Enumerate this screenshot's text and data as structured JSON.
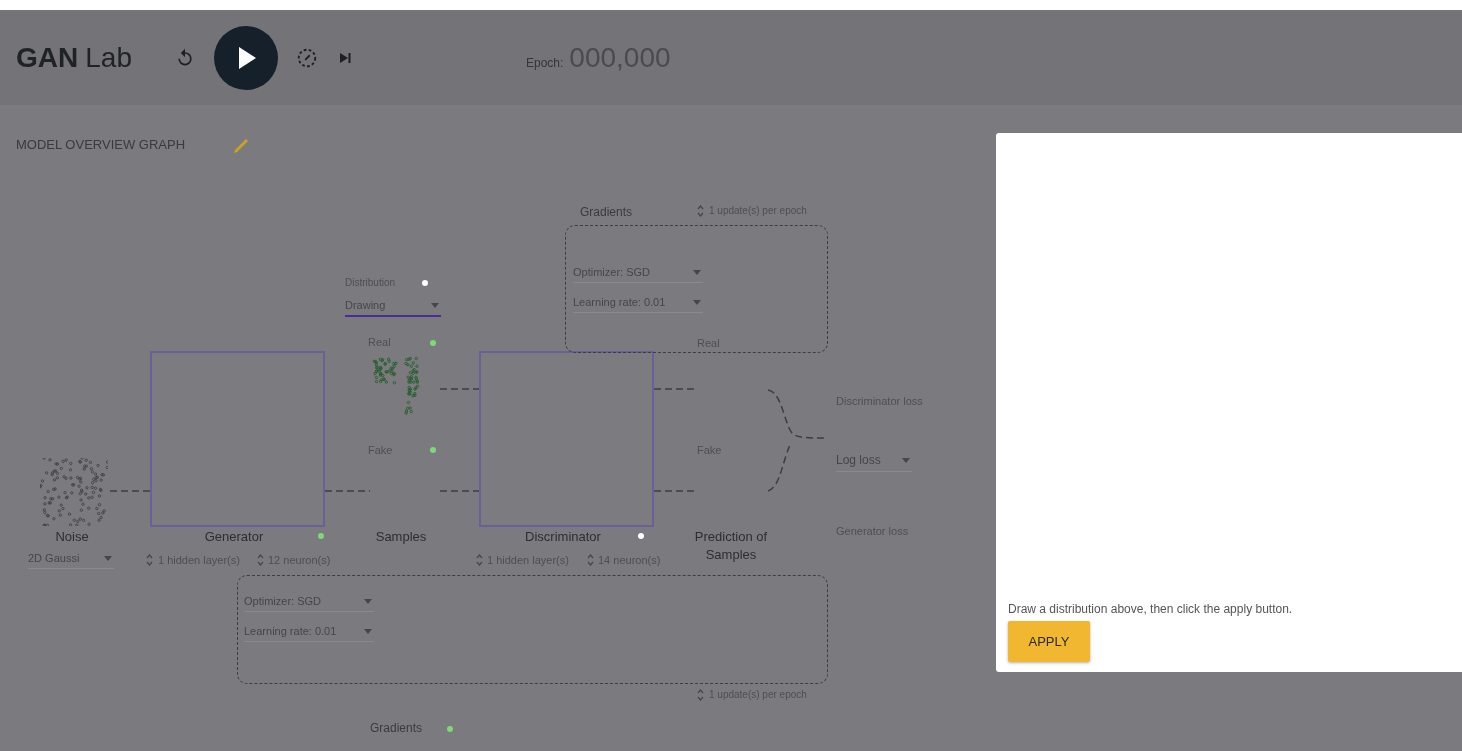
{
  "header": {
    "logo_bold": "GAN",
    "logo_light": "Lab",
    "epoch_label": "Epoch:",
    "epoch_value": "000,000"
  },
  "section_title": "MODEL OVERVIEW GRAPH",
  "noise": {
    "label": "Noise",
    "distribution": "2D Gaussi"
  },
  "generator": {
    "label": "Generator",
    "indicator": {
      "color": "#7fd87a"
    },
    "layers": "1 hidden layer(s)",
    "neurons": "12 neuron(s)"
  },
  "samples": {
    "label": "Samples",
    "distribution_label": "Distribution",
    "distribution_indicator": {
      "color": "#ffffff"
    },
    "distribution_value": "Drawing",
    "real": "Real",
    "real_indicator": {
      "color": "#7fd87a"
    },
    "fake": "Fake",
    "fake_indicator": {
      "color": "#7fd87a"
    }
  },
  "discriminator": {
    "label": "Discriminator",
    "indicator": {
      "color": "#ffffff"
    },
    "layers": "1 hidden layer(s)",
    "neurons": "14 neuron(s)"
  },
  "prediction": {
    "label": "Prediction of Samples",
    "real": "Real",
    "fake": "Fake"
  },
  "loss": {
    "discriminator_loss": "Discriminator loss",
    "loss_function": "Log loss",
    "generator_loss": "Generator loss"
  },
  "discriminator_gradients": {
    "title": "Gradients",
    "updates": "1 update(s) per epoch",
    "optimizer": "Optimizer: SGD",
    "learning_rate": "Learning rate: 0.01"
  },
  "generator_gradients": {
    "title": "Gradients",
    "indicator": {
      "color": "#7fd87a"
    },
    "updates": "1 update(s) per epoch",
    "optimizer": "Optimizer: SGD",
    "learning_rate": "Learning rate: 0.01"
  },
  "draw_panel": {
    "hint": "Draw a distribution above, then click the apply button.",
    "button": "APPLY"
  }
}
